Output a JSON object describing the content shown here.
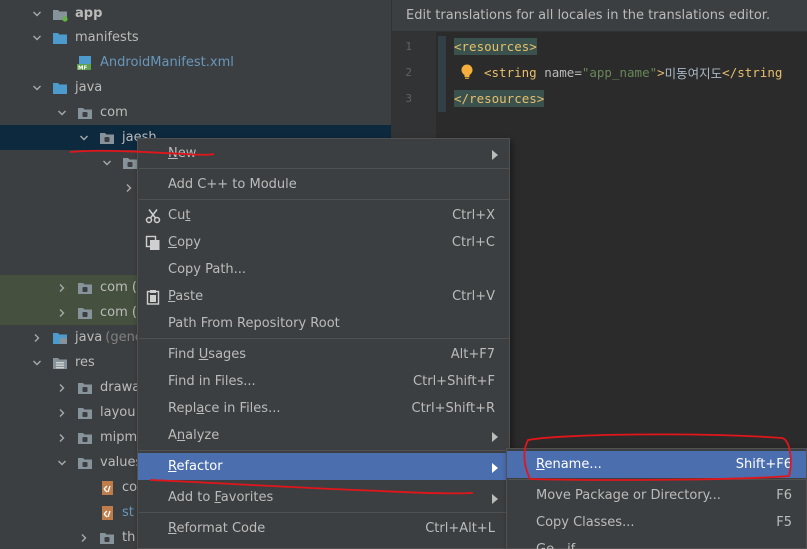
{
  "tree": {
    "items": [
      {
        "label": "app",
        "indent": 1,
        "arrow": "down",
        "icon": "module-icon",
        "bold": true
      },
      {
        "label": "manifests",
        "indent": 2,
        "arrow": "down",
        "icon": "folder-icon-blue"
      },
      {
        "label": "AndroidManifest.xml",
        "indent": 3,
        "arrow": "none",
        "icon": "manifest-file-icon",
        "blue": true
      },
      {
        "label": "java",
        "indent": 2,
        "arrow": "down",
        "icon": "folder-icon-blue"
      },
      {
        "label": "com",
        "indent": 3,
        "arrow": "down",
        "icon": "package-icon"
      },
      {
        "label": "jaesh",
        "indent": 4,
        "arrow": "down",
        "icon": "package-icon",
        "selected": true
      },
      {
        "label": "",
        "indent": 5,
        "arrow": "down",
        "icon": "package-icon"
      },
      {
        "label": "",
        "indent": 6,
        "arrow": "right",
        "icon": "none"
      },
      {
        "label": "",
        "indent": 0,
        "arrow": "none",
        "icon": "none"
      },
      {
        "label": "",
        "indent": 0,
        "arrow": "none",
        "icon": "none"
      },
      {
        "label": "",
        "indent": 0,
        "arrow": "none",
        "icon": "none"
      },
      {
        "label": "com (",
        "indent": 3,
        "arrow": "right",
        "icon": "package-icon",
        "tinted": true
      },
      {
        "label": "com (",
        "indent": 3,
        "arrow": "right",
        "icon": "package-icon",
        "tinted": true
      },
      {
        "label": "java",
        "indent": 2,
        "arrow": "right",
        "icon": "folder-icon-generated",
        "suffix": "(gene"
      },
      {
        "label": "res",
        "indent": 2,
        "arrow": "down",
        "icon": "folder-icon-res"
      },
      {
        "label": "drawa",
        "indent": 3,
        "arrow": "right",
        "icon": "package-icon"
      },
      {
        "label": "layou",
        "indent": 3,
        "arrow": "right",
        "icon": "package-icon"
      },
      {
        "label": "mipm",
        "indent": 3,
        "arrow": "right",
        "icon": "package-icon"
      },
      {
        "label": "values",
        "indent": 3,
        "arrow": "down",
        "icon": "package-icon"
      },
      {
        "label": "co",
        "indent": 4,
        "arrow": "none",
        "icon": "values-file-icon"
      },
      {
        "label": "st",
        "indent": 4,
        "arrow": "none",
        "icon": "values-file-icon",
        "blue": true
      },
      {
        "label": "th",
        "indent": 4,
        "arrow": "right",
        "icon": "package-icon"
      }
    ]
  },
  "editor": {
    "banner": "Edit translations for all locales in the translations editor.",
    "lines": [
      {
        "num": "1",
        "open_tag": "<resources>"
      },
      {
        "num": "2",
        "tag_open": "<string",
        "attr_name": "name",
        "attr_eq": "=",
        "attr_value": "\"app_name\"",
        "tag_close": ">",
        "text": "미동여지도",
        "end_tag": "</string"
      },
      {
        "num": "3",
        "close_tag": "</resources>"
      }
    ]
  },
  "menu": {
    "items": [
      {
        "label": "New",
        "mnemonic_index": 0,
        "shortcut": "",
        "submenu": true
      },
      {
        "label": "Add C++ to Module",
        "shortcut": "",
        "submenu": false
      },
      {
        "label": "Cut",
        "mnemonic_index": 2,
        "shortcut": "Ctrl+X",
        "icon": "scissors-icon"
      },
      {
        "label": "Copy",
        "mnemonic_index": 0,
        "shortcut": "Ctrl+C",
        "icon": "copy-icon"
      },
      {
        "label": "Copy Path...",
        "shortcut": ""
      },
      {
        "label": "Paste",
        "mnemonic_index": 0,
        "shortcut": "Ctrl+V",
        "icon": "clipboard-icon"
      },
      {
        "label": "Path From Repository Root",
        "shortcut": ""
      },
      {
        "label": "Find Usages",
        "mnemonic_index": 5,
        "shortcut": "Alt+F7"
      },
      {
        "label": "Find in Files...",
        "shortcut": "Ctrl+Shift+F"
      },
      {
        "label": "Replace in Files...",
        "mnemonic_index": 4,
        "shortcut": "Ctrl+Shift+R"
      },
      {
        "label": "Analyze",
        "mnemonic_index": 1,
        "shortcut": "",
        "submenu": true
      },
      {
        "label": "Refactor",
        "mnemonic_index": 0,
        "shortcut": "",
        "submenu": true,
        "active": true
      },
      {
        "label": "Add to Favorites",
        "mnemonic_index": 7,
        "shortcut": "",
        "submenu": true
      },
      {
        "label": "Reformat Code",
        "mnemonic_index": 0,
        "shortcut": "Ctrl+Alt+L"
      }
    ]
  },
  "submenu": {
    "items": [
      {
        "label": "Rename...",
        "mnemonic_index": 0,
        "shortcut": "Shift+F6",
        "active": true
      },
      {
        "label": "Move Package or Directory...",
        "shortcut": "F6"
      },
      {
        "label": "Copy Classes...",
        "shortcut": "F5"
      },
      {
        "label": "Ge…if",
        "shortcut": ""
      }
    ]
  },
  "colors": {
    "tree_bg": "#3c3f41",
    "editor_bg": "#2b2b2b",
    "menu_bg": "#3c3f41",
    "highlight": "#4b6eaf",
    "selection": "#0d293e",
    "annotation": "#e0161b",
    "xml_tag": "#e8bf6a",
    "xml_value": "#6a8759"
  }
}
